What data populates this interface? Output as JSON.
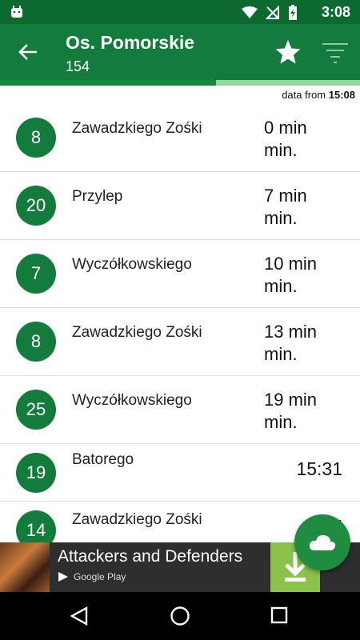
{
  "status_bar": {
    "time": "3:08"
  },
  "app_bar": {
    "title": "Os. Pomorskie",
    "subtitle": "154"
  },
  "progress": {
    "fraction": 0.6
  },
  "data_from": {
    "prefix": "data from",
    "time": "15:08"
  },
  "departures": [
    {
      "line": "8",
      "destination": "Zawadzkiego Zośki",
      "eta_line1": "0 min",
      "eta_line2": "min."
    },
    {
      "line": "20",
      "destination": "Przylep",
      "eta_line1": "7 min",
      "eta_line2": "min."
    },
    {
      "line": "7",
      "destination": "Wyczółkowskiego",
      "eta_line1": "10 min",
      "eta_line2": "min."
    },
    {
      "line": "8",
      "destination": "Zawadzkiego Zośki",
      "eta_line1": "13 min",
      "eta_line2": "min."
    },
    {
      "line": "25",
      "destination": "Wyczółkowskiego",
      "eta_line1": "19 min",
      "eta_line2": "min."
    },
    {
      "line": "19",
      "destination": "Batorego",
      "time": "15:31"
    },
    {
      "line": "14",
      "destination": "Zawadzkiego Zośki",
      "time": "15"
    }
  ],
  "ad": {
    "title": "Attackers and Defenders",
    "store": "Google Play"
  },
  "colors": {
    "primary": "#137c3c",
    "primary_dark": "#0c6a2f",
    "progress_track": "#93d69f",
    "fab": "#1f8c3f"
  }
}
